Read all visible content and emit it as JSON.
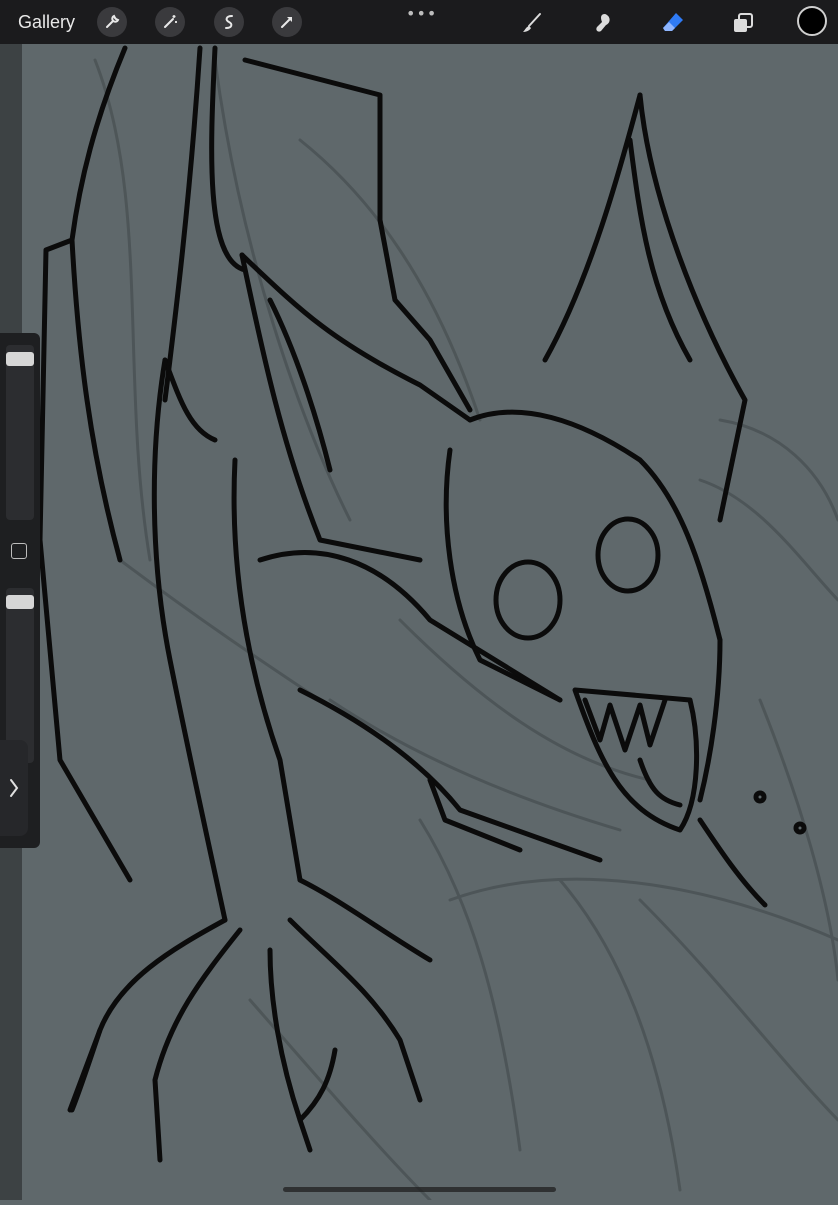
{
  "topbar": {
    "gallery_label": "Gallery",
    "more_dots": "•••",
    "left_tools": [
      "wrench-icon",
      "magic-wand-icon",
      "selection-icon",
      "transform-icon"
    ],
    "right_tools": [
      "brush-icon",
      "smudge-icon",
      "eraser-icon",
      "layers-icon"
    ],
    "active_tool": "eraser-icon",
    "accent_color": "#2f7bf5",
    "current_color": "#000000"
  },
  "sidebar": {
    "brush_size_level": 0.05,
    "opacity_level": 0.02,
    "toggle_icon": "chevron-right-icon"
  },
  "canvas": {
    "background_color": "#5f686b",
    "subject": "bat-creature-lineart"
  }
}
